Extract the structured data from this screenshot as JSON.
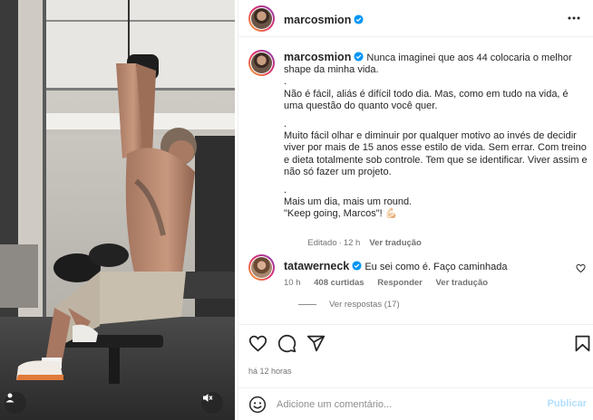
{
  "post": {
    "author": "marcosmion",
    "verified": true
  },
  "caption": {
    "author": "marcosmion",
    "lines": [
      "Nunca imaginei que aos 44 colocaria o melhor shape da minha vida.",
      ".",
      "Não é fácil, aliás é difícil todo dia. Mas, como em tudo na vida, é uma questão do quanto você quer.",
      ".",
      "Muito fácil olhar e diminuir por qualquer motivo ao invés de decidir viver por mais de 15 anos esse estilo de vida. Sem errar. Com treino e dieta totalmente sob controle. Tem que se identificar. Viver assim e não só fazer um projeto.",
      ".",
      "Mais um dia, mais um round.",
      "\"Keep going, Marcos\"! 💪🏻"
    ],
    "edited": "Editado",
    "time": "12 h",
    "see_translation": "Ver tradução"
  },
  "comment": {
    "author": "tatawerneck",
    "verified": true,
    "text": "Eu sei como é. Faço caminhada",
    "time": "10 h",
    "likes": "408 curtidas",
    "reply": "Responder",
    "see_translation": "Ver tradução",
    "view_replies": "Ver respostas (17)"
  },
  "footer": {
    "time_ago": "há 12 horas",
    "comment_placeholder": "Adicione um comentário...",
    "publish": "Publicar"
  },
  "icons": {
    "more": "more-horizontal-icon",
    "like": "heart-icon",
    "comment": "comment-icon",
    "share": "send-icon",
    "save": "bookmark-icon",
    "emoji": "emoji-icon",
    "user_tag": "user-tag-icon",
    "mute": "mute-icon"
  },
  "colors": {
    "verified": "#0095f6",
    "publish_disabled": "#b2dffc",
    "secondary_text": "#737373"
  }
}
